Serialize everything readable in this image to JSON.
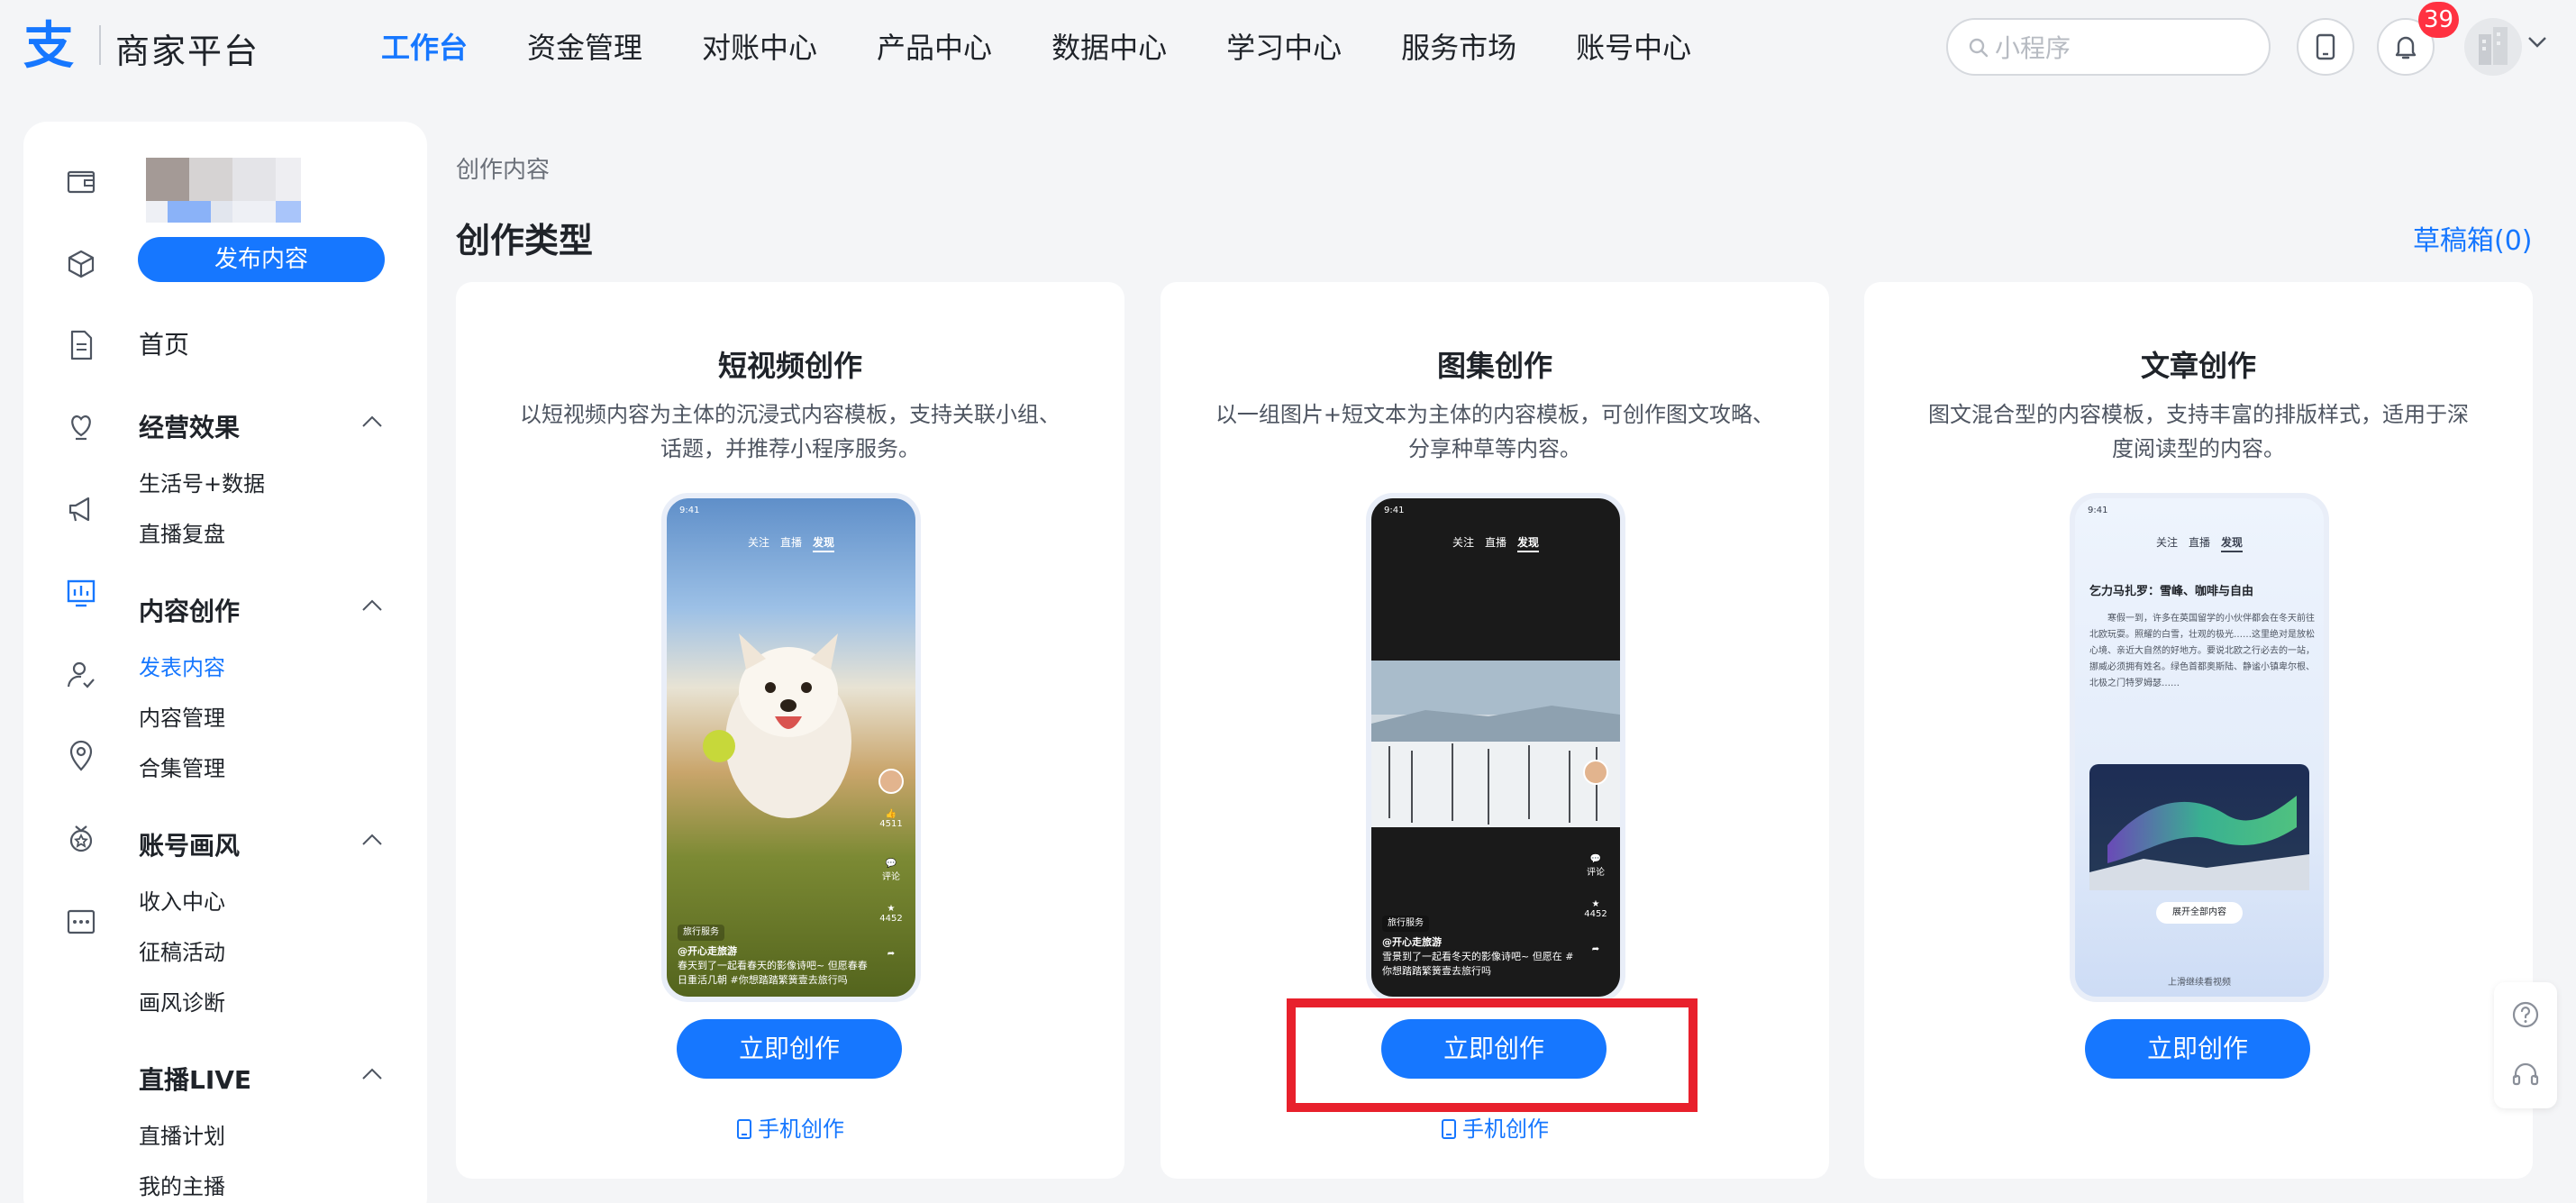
{
  "header": {
    "brand": "商家平台",
    "nav": [
      "工作台",
      "资金管理",
      "对账中心",
      "产品中心",
      "数据中心",
      "学习中心",
      "服务市场",
      "账号中心"
    ],
    "search_placeholder": "小程序",
    "notification_count": "39"
  },
  "sidebar": {
    "publish_button": "发布内容",
    "home": "首页",
    "groups": [
      {
        "title": "经营效果",
        "items": [
          "生活号+数据",
          "直播复盘"
        ]
      },
      {
        "title": "内容创作",
        "items": [
          "发表内容",
          "内容管理",
          "合集管理"
        ]
      },
      {
        "title": "账号画风",
        "items": [
          "收入中心",
          "征稿活动",
          "画风诊断"
        ]
      },
      {
        "title": "直播LIVE",
        "items": [
          "直播计划",
          "我的主播"
        ]
      }
    ]
  },
  "main": {
    "breadcrumb": "创作内容",
    "section_title": "创作类型",
    "draft_link": "草稿箱(0)",
    "cards": [
      {
        "title": "短视频创作",
        "desc": "以短视频内容为主体的沉浸式内容模板，支持关联小组、话题，并推荐小程序服务。",
        "button": "立即创作",
        "mobile_link": "手机创作"
      },
      {
        "title": "图集创作",
        "desc": "以一组图片+短文本为主体的内容模板，可创作图文攻略、分享种草等内容。",
        "button": "立即创作",
        "mobile_link": "手机创作"
      },
      {
        "title": "文章创作",
        "desc": "图文混合型的内容模板，支持丰富的排版样式，适用于深度阅读型的内容。",
        "button": "立即创作"
      }
    ],
    "phone_preview": {
      "time": "9:41",
      "tabs": [
        "关注",
        "直播",
        "发现"
      ],
      "service_tag": "旅行服务",
      "author": "@开心走旅游",
      "caption": "春天到了一起看春天的影像诗吧~ 但愿春春日重活几朝 #你想踏踏繁簧壹去旅行吗",
      "caption2": "雪景到了一起看冬天的影像诗吧~ 但愿在 # 你想踏踏繁簧壹去旅行吗",
      "like_count": "4511",
      "comment_label": "评论",
      "star_count": "4452",
      "follow_label": "关注",
      "article_title": "乞力马扎罗：雪峰、咖啡与自由",
      "article_body": "寒假一到，许多在英国留学的小伙伴都会在冬天前往北欧玩耍。照耀的白雪，壮观的极光……这里绝对是放松心境、亲近大自然的好地方。要说北欧之行必去的一站，挪威必须拥有姓名。绿色首都奥斯陆、静谧小镇卑尔根、北极之门特罗姆瑟……",
      "article_more": "展开全部内容",
      "article_footer": "上滑继续看视频"
    }
  },
  "colors": {
    "accent": "#1677ff",
    "badge": "#ff3141",
    "highlight": "#e8202c"
  }
}
